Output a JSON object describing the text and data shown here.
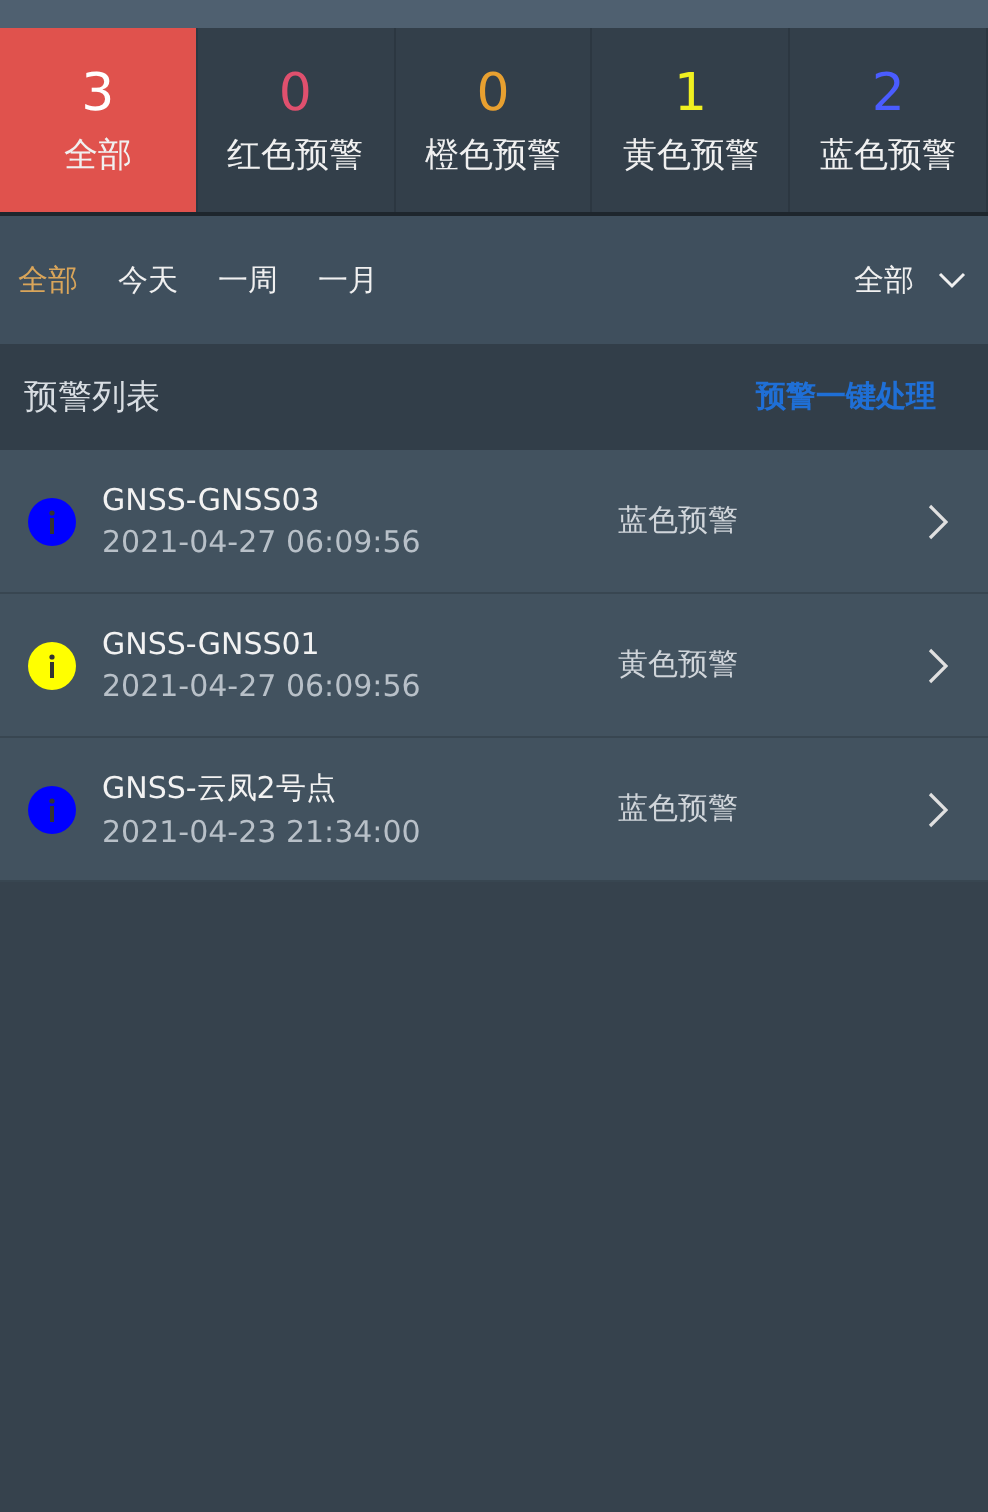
{
  "level_tabs": [
    {
      "count": "3",
      "label": "全部",
      "selected": true,
      "color": "#ffffff"
    },
    {
      "count": "0",
      "label": "红色预警",
      "selected": false,
      "color": "#e0506e"
    },
    {
      "count": "0",
      "label": "橙色预警",
      "selected": false,
      "color": "#e8a030"
    },
    {
      "count": "1",
      "label": "黄色预警",
      "selected": false,
      "color": "#f0f020"
    },
    {
      "count": "2",
      "label": "蓝色预警",
      "selected": false,
      "color": "#4a5cff"
    }
  ],
  "time_filters": [
    {
      "label": "全部",
      "selected": true
    },
    {
      "label": "今天",
      "selected": false
    },
    {
      "label": "一周",
      "selected": false
    },
    {
      "label": "一月",
      "selected": false
    }
  ],
  "type_dropdown": {
    "value": "全部"
  },
  "list_header": {
    "title": "预警列表",
    "action": "预警一键处理"
  },
  "alerts": [
    {
      "name": "GNSS-GNSS03",
      "time": "2021-04-27 06:09:56",
      "level": "蓝色预警",
      "color": "#0000ff"
    },
    {
      "name": "GNSS-GNSS01",
      "time": "2021-04-27 06:09:56",
      "level": "黄色预警",
      "color": "#ffff00"
    },
    {
      "name": "GNSS-云凤2号点",
      "time": "2021-04-23 21:34:00",
      "level": "蓝色预警",
      "color": "#0000ff"
    }
  ]
}
